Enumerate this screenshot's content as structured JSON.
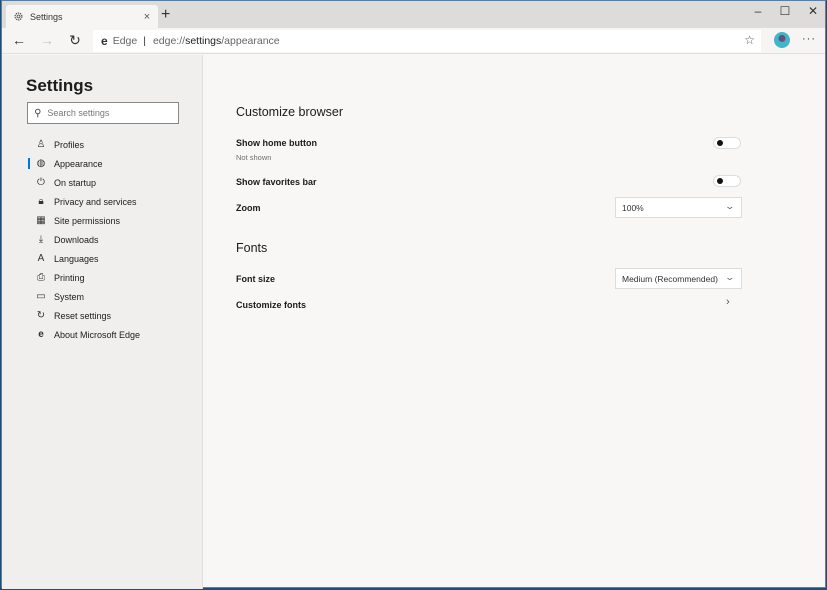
{
  "browser": {
    "tab": {
      "title": "Settings",
      "icon": "gear-icon",
      "close": "×"
    },
    "new_tab": "+",
    "window_controls": {
      "minimize": "–",
      "maximize": "☐",
      "close": "✕"
    },
    "nav": {
      "back": "←",
      "forward": "→",
      "refresh": "↻"
    },
    "address": {
      "brand_icon": "e",
      "brand": "Edge",
      "separator": "|",
      "url_prefix": "edge://",
      "url_strong": "settings",
      "url_suffix": "/appearance"
    },
    "favorite_icon": "☆",
    "more": "···"
  },
  "sidebar": {
    "title": "Settings",
    "search_placeholder": "Search settings",
    "items": [
      {
        "label": "Profiles",
        "icon": "person-icon",
        "glyph": "♙",
        "active": false
      },
      {
        "label": "Appearance",
        "icon": "palette-icon",
        "glyph": "◍",
        "active": true
      },
      {
        "label": "On startup",
        "icon": "power-icon",
        "glyph": "⏻",
        "active": false
      },
      {
        "label": "Privacy and services",
        "icon": "lock-icon",
        "glyph": "🔒︎",
        "active": false
      },
      {
        "label": "Site permissions",
        "icon": "site-permissions-icon",
        "glyph": "▦",
        "active": false
      },
      {
        "label": "Downloads",
        "icon": "download-icon",
        "glyph": "⤓",
        "active": false
      },
      {
        "label": "Languages",
        "icon": "languages-icon",
        "glyph": "A",
        "active": false
      },
      {
        "label": "Printing",
        "icon": "printer-icon",
        "glyph": "⎙",
        "active": false
      },
      {
        "label": "System",
        "icon": "laptop-icon",
        "glyph": "▭",
        "active": false
      },
      {
        "label": "Reset settings",
        "icon": "reset-icon",
        "glyph": "↻",
        "active": false
      },
      {
        "label": "About Microsoft Edge",
        "icon": "edge-logo-icon",
        "glyph": "e",
        "active": false
      }
    ]
  },
  "main": {
    "customize": {
      "title": "Customize browser",
      "show_home": {
        "label": "Show home button",
        "sub": "Not shown",
        "enabled": false
      },
      "show_favorites": {
        "label": "Show favorites bar",
        "enabled": false
      },
      "zoom": {
        "label": "Zoom",
        "value": "100%"
      }
    },
    "fonts": {
      "title": "Fonts",
      "font_size": {
        "label": "Font size",
        "value": "Medium (Recommended)"
      },
      "customize_fonts": {
        "label": "Customize fonts",
        "chevron": "›"
      }
    },
    "dropdown_chevron": "⌄"
  }
}
